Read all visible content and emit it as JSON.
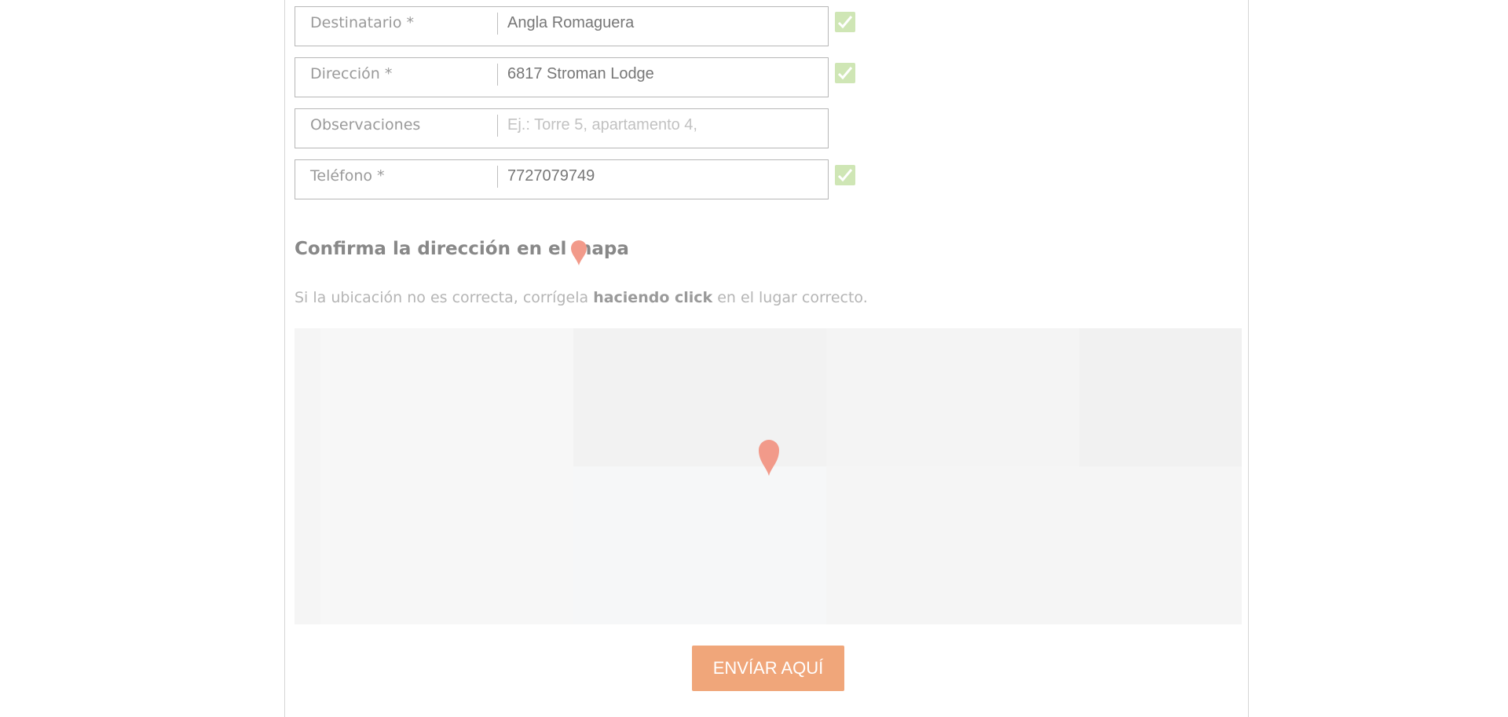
{
  "form": {
    "fields": [
      {
        "label": "Destinatario *",
        "value": "Angla Romaguera",
        "placeholder": "",
        "valid": true
      },
      {
        "label": "Dirección *",
        "value": "6817 Stroman Lodge",
        "placeholder": "",
        "valid": true
      },
      {
        "label": "Observaciones",
        "value": "",
        "placeholder": "Ej.: Torre 5, apartamento 4,",
        "valid": false
      },
      {
        "label": "Teléfono *",
        "value": "7727079749",
        "placeholder": "",
        "valid": true
      }
    ]
  },
  "map_section": {
    "title": "Confirma la dirección en el mapa",
    "hint_before": "Si la ubicación no es correcta, corrígela ",
    "hint_bold": "haciendo click",
    "hint_after": " en el lugar correcto."
  },
  "actions": {
    "send_label": "ENVÍAR AQUÍ"
  },
  "colors": {
    "accent": "#f0a67a",
    "pin": "#f29a8a",
    "check": "#cfe6b5"
  }
}
